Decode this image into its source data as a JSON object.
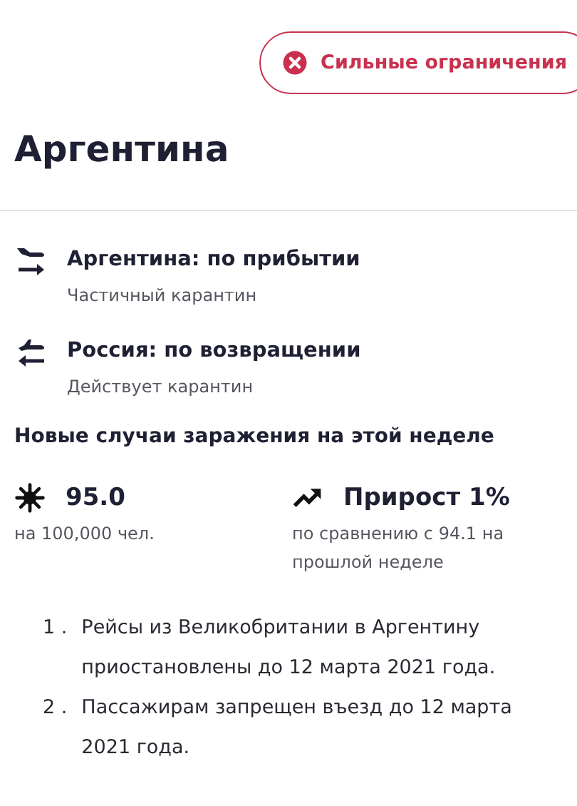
{
  "badge": {
    "label": "Сильные ограничения"
  },
  "title": "Аргентина",
  "rules": [
    {
      "kind": "arrival",
      "title": "Аргентина: по прибытии",
      "detail": "Частичный карантин"
    },
    {
      "kind": "return",
      "title": "Россия: по возвращении",
      "detail": "Действует карантин"
    }
  ],
  "cases": {
    "heading": "Новые случаи заражения на этой неделе",
    "stats": [
      {
        "kind": "virus",
        "value": "95.0",
        "note": "на 100,000 чел."
      },
      {
        "kind": "trend",
        "value": "Прирост 1%",
        "note": "по сравнению с 94.1 на прошлой неделе"
      }
    ]
  },
  "notes": [
    {
      "number": "1 .",
      "text": "Рейсы из Великобритании в Аргентину приостановлены до 12 марта 2021 года."
    },
    {
      "number": "2 .",
      "text": "Пассажирам запрещен въезд до 12 марта 2021 года."
    }
  ]
}
